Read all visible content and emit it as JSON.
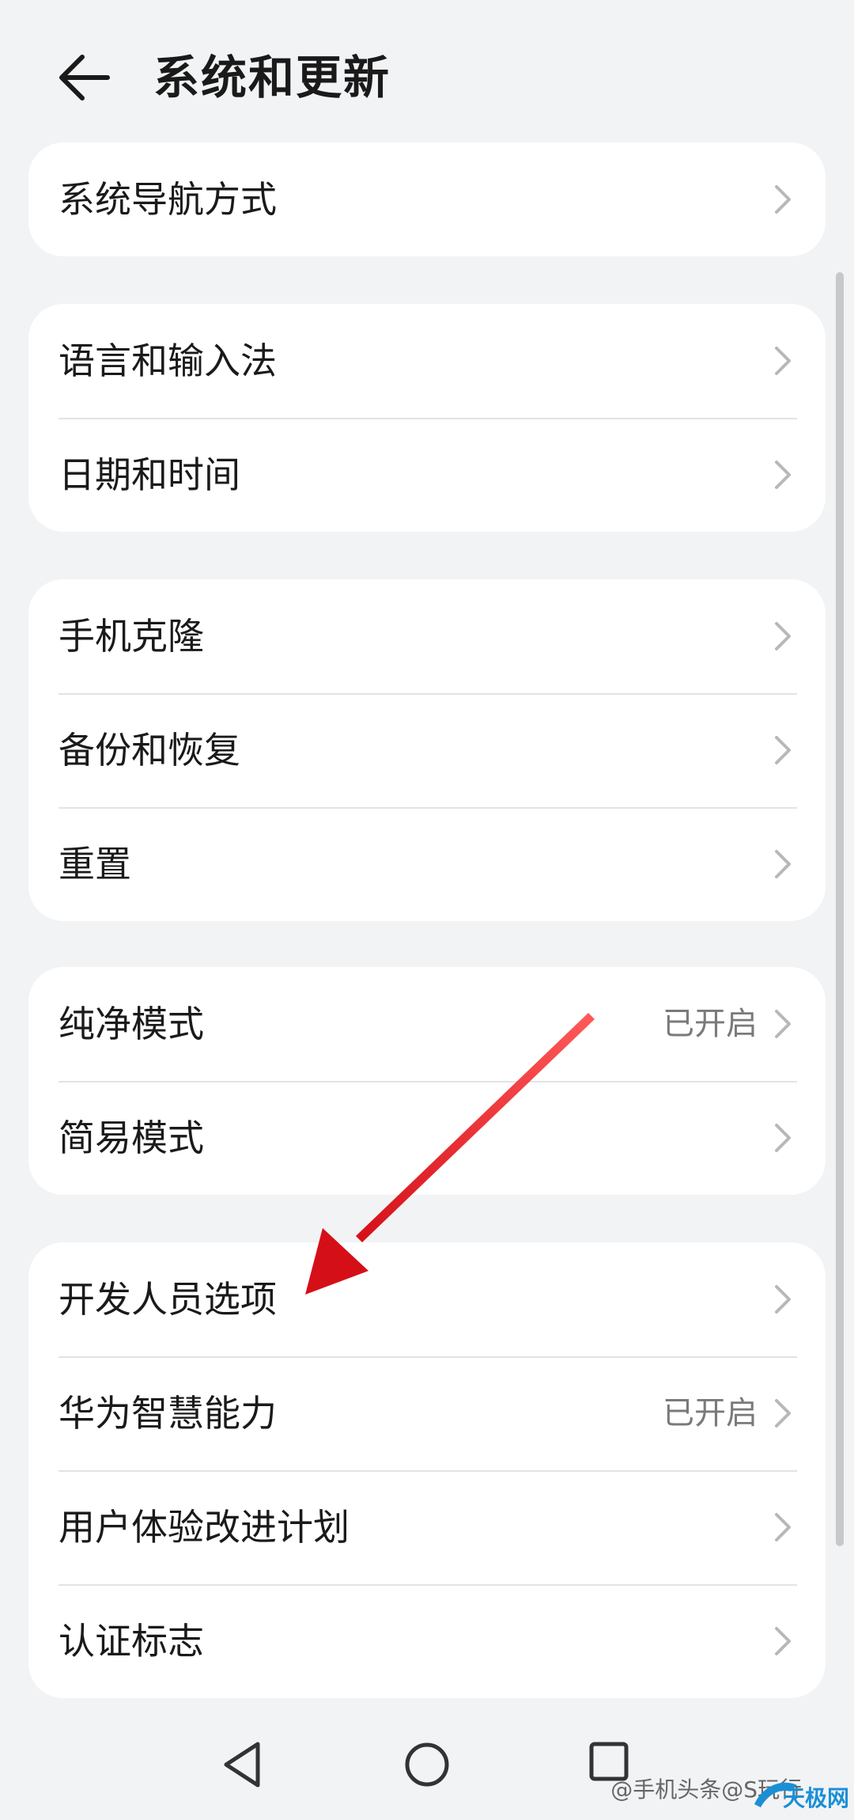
{
  "header": {
    "title": "系统和更新"
  },
  "cards": [
    {
      "items": [
        {
          "label": "系统导航方式",
          "status": ""
        }
      ]
    },
    {
      "items": [
        {
          "label": "语言和输入法",
          "status": ""
        },
        {
          "label": "日期和时间",
          "status": ""
        }
      ]
    },
    {
      "items": [
        {
          "label": "手机克隆",
          "status": ""
        },
        {
          "label": "备份和恢复",
          "status": ""
        },
        {
          "label": "重置",
          "status": ""
        }
      ]
    },
    {
      "items": [
        {
          "label": "纯净模式",
          "status": "已开启"
        },
        {
          "label": "简易模式",
          "status": ""
        }
      ]
    },
    {
      "items": [
        {
          "label": "开发人员选项",
          "status": ""
        },
        {
          "label": "华为智慧能力",
          "status": "已开启"
        },
        {
          "label": "用户体验改进计划",
          "status": ""
        },
        {
          "label": "认证标志",
          "status": ""
        }
      ]
    }
  ],
  "watermark": {
    "text": "@手机头条@S玩行"
  },
  "corner_logo": {
    "text": "天极网"
  },
  "colors": {
    "background": "#f1f3f5",
    "card": "#ffffff",
    "status": "#7a7a7a",
    "annotation_arrow": "#e0141e"
  },
  "icons": {
    "back": "back-arrow-icon",
    "chevron": "chevron-right-icon",
    "nav_back": "triangle-back-icon",
    "nav_home": "circle-home-icon",
    "nav_recent": "square-recent-icon"
  }
}
